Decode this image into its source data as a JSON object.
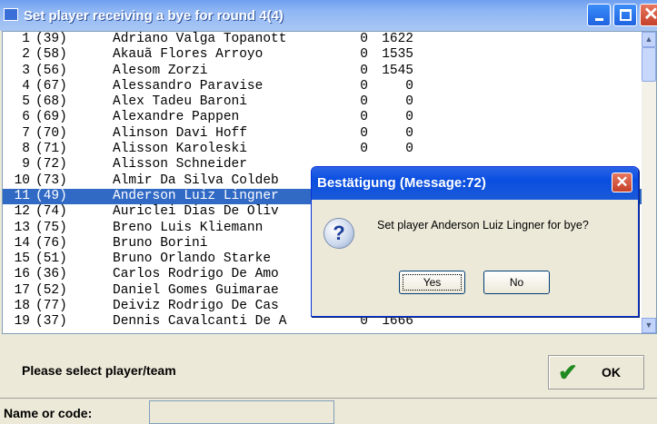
{
  "window": {
    "title": "Set player receiving a bye for round 4(4)"
  },
  "players": [
    {
      "num": "1",
      "code": "(39)",
      "name": "Adriano Valga Topanott",
      "pts": "0",
      "rating": "1622"
    },
    {
      "num": "2",
      "code": "(58)",
      "name": "Akauã Flores Arroyo",
      "pts": "0",
      "rating": "1535"
    },
    {
      "num": "3",
      "code": "(56)",
      "name": "Alesom Zorzi",
      "pts": "0",
      "rating": "1545"
    },
    {
      "num": "4",
      "code": "(67)",
      "name": "Alessandro Paravise",
      "pts": "0",
      "rating": "0"
    },
    {
      "num": "5",
      "code": "(68)",
      "name": "Alex Tadeu Baroni",
      "pts": "0",
      "rating": "0"
    },
    {
      "num": "6",
      "code": "(69)",
      "name": "Alexandre Pappen",
      "pts": "0",
      "rating": "0"
    },
    {
      "num": "7",
      "code": "(70)",
      "name": "Alinson Davi Hoff",
      "pts": "0",
      "rating": "0"
    },
    {
      "num": "8",
      "code": "(71)",
      "name": "Alisson Karoleski",
      "pts": "0",
      "rating": "0"
    },
    {
      "num": "9",
      "code": "(72)",
      "name": "Alisson Schneider",
      "pts": "",
      "rating": ""
    },
    {
      "num": "10",
      "code": "(73)",
      "name": "Almir Da Silva Coldeb",
      "pts": "",
      "rating": ""
    },
    {
      "num": "11",
      "code": "(49)",
      "name": "Anderson Luiz Lingner",
      "pts": "",
      "rating": "",
      "selected": true
    },
    {
      "num": "12",
      "code": "(74)",
      "name": "Auriclei Dias De Oliv",
      "pts": "",
      "rating": ""
    },
    {
      "num": "13",
      "code": "(75)",
      "name": "Breno Luis Kliemann",
      "pts": "",
      "rating": ""
    },
    {
      "num": "14",
      "code": "(76)",
      "name": "Bruno Borini",
      "pts": "",
      "rating": ""
    },
    {
      "num": "15",
      "code": "(51)",
      "name": "Bruno Orlando Starke",
      "pts": "",
      "rating": ""
    },
    {
      "num": "16",
      "code": "(36)",
      "name": "Carlos Rodrigo De Amo",
      "pts": "",
      "rating": ""
    },
    {
      "num": "17",
      "code": "(52)",
      "name": "Daniel Gomes Guimarae",
      "pts": "",
      "rating": ""
    },
    {
      "num": "18",
      "code": "(77)",
      "name": "Deiviz Rodrigo De Cas",
      "pts": "",
      "rating": ""
    },
    {
      "num": "19",
      "code": "(37)",
      "name": "Dennis Cavalcanti De A",
      "pts": "0",
      "rating": "1666"
    }
  ],
  "footer": {
    "prompt": "Please select player/team",
    "ok_label": "OK",
    "name_label": "Name or code:",
    "name_value": ""
  },
  "dialog": {
    "title": "Bestätigung (Message:72)",
    "message": "Set player Anderson Luiz Lingner for bye?",
    "yes_label": "Yes",
    "no_label": "No",
    "close_glyph": "✕"
  },
  "icons": {
    "question": "?",
    "check": "✔",
    "scroll_up": "▲",
    "scroll_down": "▼"
  },
  "colors": {
    "selection": "#316ac5",
    "titlebar": "#8fb6f4",
    "dialog_titlebar": "#0a4ee0"
  }
}
